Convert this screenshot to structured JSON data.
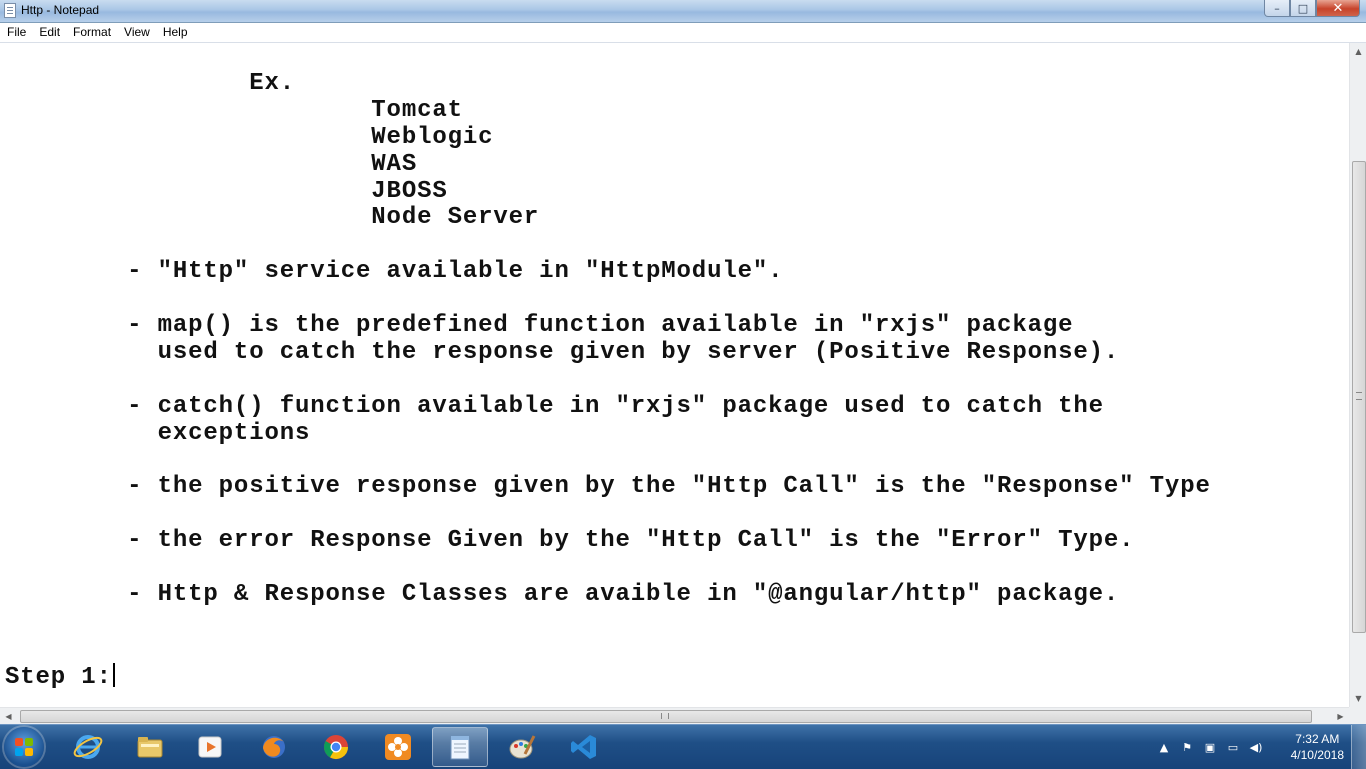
{
  "window": {
    "title": "Http - Notepad",
    "minimize_glyph": "–",
    "maximize_glyph": "□",
    "close_glyph": "✕"
  },
  "menu": [
    "File",
    "Edit",
    "Format",
    "View",
    "Help"
  ],
  "editor": {
    "lines": [
      "                Ex.",
      "                        Tomcat",
      "                        Weblogic",
      "                        WAS",
      "                        JBOSS",
      "                        Node Server",
      "",
      "        - \"Http\" service available in \"HttpModule\".",
      "",
      "        - map() is the predefined function available in \"rxjs\" package",
      "          used to catch the response given by server (Positive Response).",
      "",
      "        - catch() function available in \"rxjs\" package used to catch the",
      "          exceptions",
      "",
      "        - the positive response given by the \"Http Call\" is the \"Response\" Type",
      "",
      "        - the error Response Given by the \"Http Call\" is the \"Error\" Type.",
      "",
      "        - Http & Response Classes are avaible in \"@angular/http\" package.",
      "",
      "",
      "Step 1:"
    ]
  },
  "taskbar": {
    "apps": [
      {
        "name": "internet-explorer-icon",
        "active": false
      },
      {
        "name": "file-explorer-icon",
        "active": false
      },
      {
        "name": "media-player-icon",
        "active": false
      },
      {
        "name": "firefox-icon",
        "active": false
      },
      {
        "name": "chrome-icon",
        "active": false
      },
      {
        "name": "orange-flower-app-icon",
        "active": false
      },
      {
        "name": "notepad-icon",
        "active": true
      },
      {
        "name": "paint-icon",
        "active": false
      },
      {
        "name": "visual-studio-code-icon",
        "active": false
      }
    ],
    "clock": {
      "time": "7:32 AM",
      "date": "4/10/2018"
    }
  },
  "colors": {
    "taskbar": "#1f4f86",
    "close_button": "#c7432a",
    "text": "#111111"
  }
}
